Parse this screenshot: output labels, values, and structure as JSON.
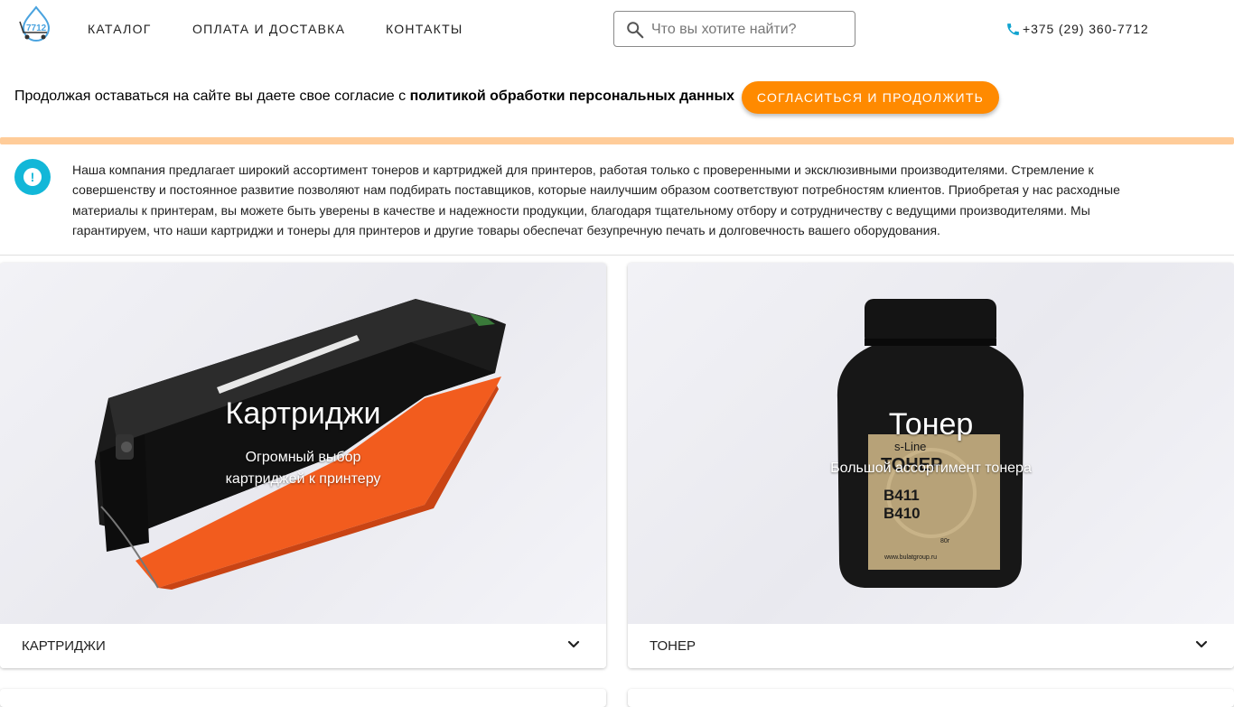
{
  "header": {
    "nav": [
      "КАТАЛОГ",
      "ОПЛАТА И ДОСТАВКА",
      "КОНТАКТЫ"
    ],
    "search_placeholder": "Что вы хотите найти?",
    "phone": "+375 (29) 360-7712",
    "logo_text": "7712"
  },
  "cookie": {
    "text": "Продолжая оставаться на сайте вы даете свое согласие с ",
    "link": "политикой обработки персональных данных",
    "button": "СОГЛАСИТЬСЯ И ПРОДОЛЖИТЬ"
  },
  "info": {
    "text": "Наша компания предлагает широкий ассортимент тонеров и картриджей для принтеров, работая только с проверенными и эксклюзивными производителями. Стремление к совершенству и постоянное развитие позволяют нам подбирать поставщиков, которые наилучшим образом соответствуют потребностям клиентов. Приобретая у нас расходные материалы к принтерам, вы можете быть уверены в качестве и надежности продукции, благодаря тщательному отбору и сотрудничеству с ведущими производителями. Мы гарантируем, что наши картриджи и тонеры для принтеров и другие товары обеспечат безупречную печать и долговечность вашего оборудования."
  },
  "cards": [
    {
      "title": "Картриджи",
      "subtitle_line1": "Огромный выбор",
      "subtitle_line2": "картриджей к принтеру",
      "footer": "КАРТРИДЖИ"
    },
    {
      "title": "Тонер",
      "subtitle": "Большой ассортимент тонера",
      "footer": "ТОНЕР",
      "bottle_label": {
        "brand": "s-Line",
        "line1": "ТОНЕР",
        "line2": "B411",
        "line3": "B410",
        "weight": "80г",
        "site": "www.bulatgroup.ru"
      }
    }
  ],
  "colors": {
    "accent": "#ff8a00",
    "info": "#12b7d8",
    "cookie_bar": "#ffcc99",
    "cartridge_orange": "#f25c1e"
  }
}
